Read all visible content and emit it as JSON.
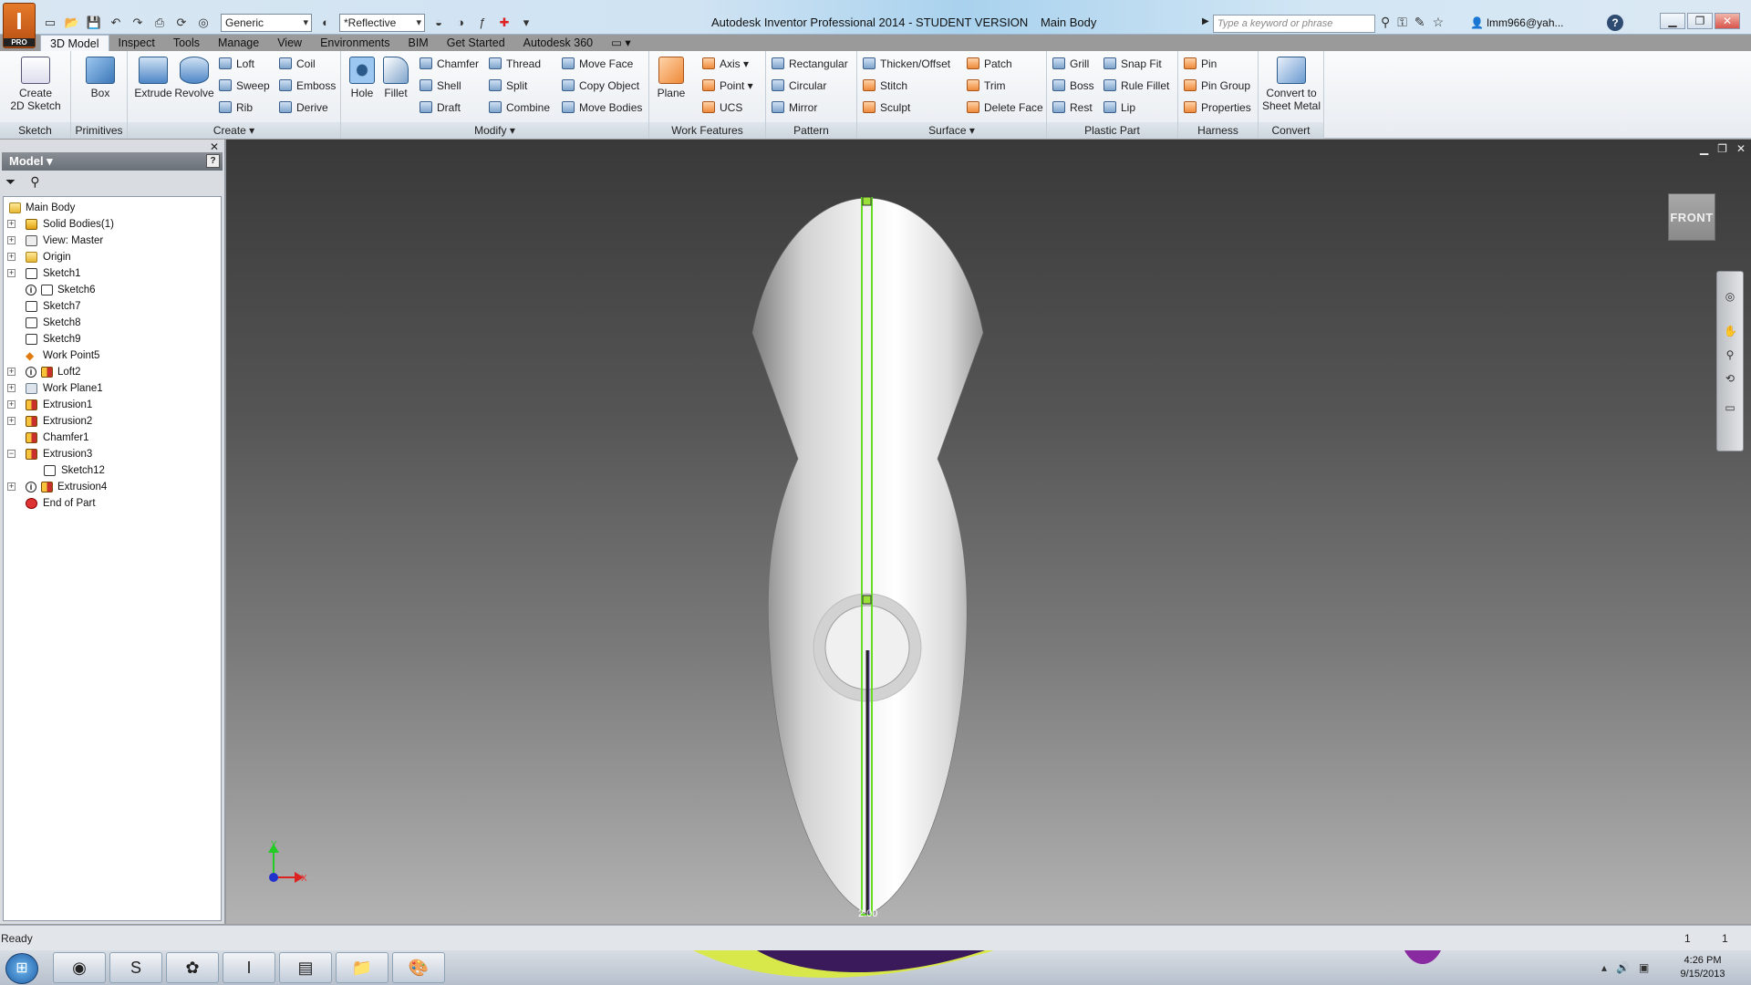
{
  "app": {
    "logo_letter": "I",
    "logo_sub": "PRO",
    "title": "Autodesk Inventor Professional 2014 - STUDENT VERSION",
    "document": "Main Body",
    "material": "Generic",
    "appearance": "*Reflective",
    "search_placeholder": "Type a keyword or phrase",
    "user": "lmm966@yah...",
    "help": "?"
  },
  "tabs": [
    "3D Model",
    "Inspect",
    "Tools",
    "Manage",
    "View",
    "Environments",
    "BIM",
    "Get Started",
    "Autodesk 360"
  ],
  "ribbon": {
    "panels": {
      "sketch": "Sketch",
      "primitives": "Primitives",
      "create": "Create ▾",
      "modify": "Modify ▾",
      "work_features": "Work Features",
      "pattern": "Pattern",
      "surface": "Surface ▾",
      "plastic_part": "Plastic Part",
      "harness": "Harness",
      "convert": "Convert"
    },
    "create_sketch": [
      "Create",
      "2D Sketch"
    ],
    "box": "Box",
    "extrude": "Extrude",
    "revolve": "Revolve",
    "loft": "Loft",
    "sweep": "Sweep",
    "rib": "Rib",
    "coil": "Coil",
    "emboss": "Emboss",
    "derive": "Derive",
    "hole": "Hole",
    "fillet": "Fillet",
    "chamfer": "Chamfer",
    "shell": "Shell",
    "draft": "Draft",
    "thread": "Thread",
    "split": "Split",
    "combine": "Combine",
    "move_face": "Move Face",
    "copy_object": "Copy Object",
    "move_bodies": "Move Bodies",
    "plane": "Plane",
    "axis": "Axis ▾",
    "point": "Point ▾",
    "ucs": "UCS",
    "rectangular": "Rectangular",
    "circular": "Circular",
    "mirror": "Mirror",
    "thicken": "Thicken/Offset",
    "stitch": "Stitch",
    "sculpt": "Sculpt",
    "patch": "Patch",
    "trim": "Trim",
    "delete_face": "Delete Face",
    "grill": "Grill",
    "boss": "Boss",
    "rest": "Rest",
    "snap_fit": "Snap Fit",
    "rule_fillet": "Rule Fillet",
    "lip": "Lip",
    "pin": "Pin",
    "pin_group": "Pin Group",
    "properties": "Properties",
    "convert_sheet": [
      "Convert to",
      "Sheet Metal"
    ]
  },
  "browser": {
    "title": "Model ▾",
    "help": "?",
    "tree": [
      {
        "label": "Main Body",
        "icon": "folder"
      },
      {
        "label": "Solid Bodies(1)",
        "icon": "solid"
      },
      {
        "label": "View: Master",
        "icon": "view"
      },
      {
        "label": "Origin",
        "icon": "folder"
      },
      {
        "label": "Sketch1",
        "icon": "sketch"
      },
      {
        "label": "Sketch6",
        "icon": "sketch"
      },
      {
        "label": "Sketch7",
        "icon": "sketch"
      },
      {
        "label": "Sketch8",
        "icon": "sketch"
      },
      {
        "label": "Sketch9",
        "icon": "sketch"
      },
      {
        "label": "Work Point5",
        "icon": "point"
      },
      {
        "label": "Loft2",
        "icon": "feature"
      },
      {
        "label": "Work Plane1",
        "icon": "plane"
      },
      {
        "label": "Extrusion1",
        "icon": "feature"
      },
      {
        "label": "Extrusion2",
        "icon": "feature"
      },
      {
        "label": "Chamfer1",
        "icon": "feature"
      },
      {
        "label": "Extrusion3",
        "icon": "feature"
      },
      {
        "label": "Sketch12",
        "icon": "sketch"
      },
      {
        "label": "Extrusion4",
        "icon": "feature"
      },
      {
        "label": "End of Part",
        "icon": "end"
      }
    ]
  },
  "viewport": {
    "viewcube_face": "FRONT",
    "dimension": "2.00",
    "axis_x": "X",
    "axis_y": "Y"
  },
  "status": {
    "text": "Ready",
    "count1": "1",
    "count2": "1"
  },
  "taskbar": {
    "time": "4:26 PM",
    "date": "9/15/2013"
  },
  "colors": {
    "accent": "#e67a2a",
    "sketch_line": "#66dd22",
    "viewport_top": "#393939",
    "viewport_bottom": "#b3b3b3"
  }
}
